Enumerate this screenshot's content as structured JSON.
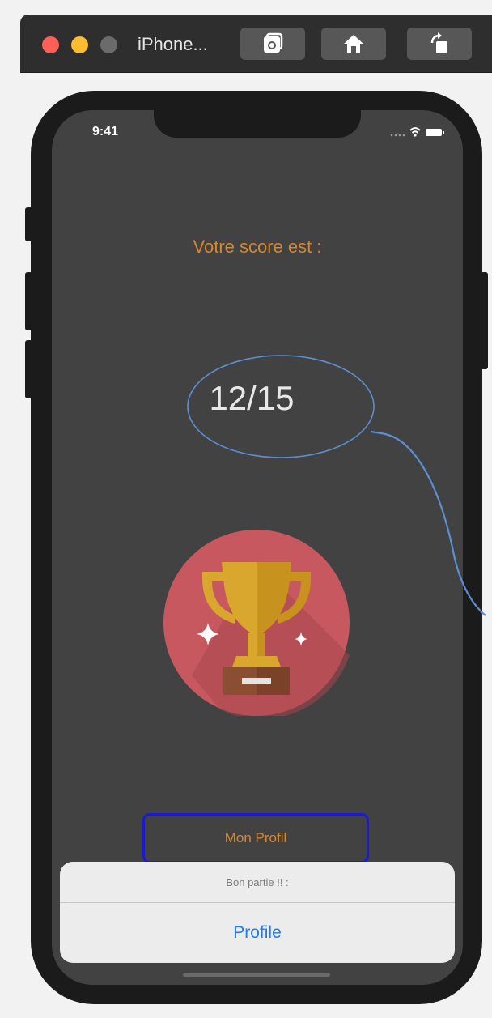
{
  "window": {
    "title": "iPhone..."
  },
  "toolbar": {
    "buttons": [
      {
        "icon": "screenshot-icon"
      },
      {
        "icon": "home-icon"
      },
      {
        "icon": "rotate-icon"
      }
    ]
  },
  "status_bar": {
    "time": "9:41"
  },
  "main": {
    "score_label": "Votre score est :",
    "score_value": "12/15",
    "profile_button_label": "Mon Profil"
  },
  "action_sheet": {
    "title": "Bon partie !! :",
    "action_label": "Profile"
  },
  "colors": {
    "accent_orange": "#d9862a",
    "action_blue": "#1d7cf2",
    "button_border": "#1a1ad6",
    "annotation_blue": "#5b8fd4",
    "trophy_circle": "#c8585f",
    "trophy_gold": "#d9a72e"
  }
}
